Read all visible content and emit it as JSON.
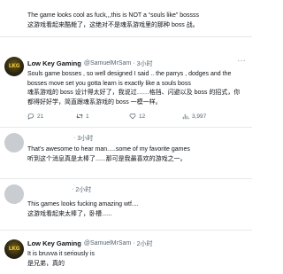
{
  "posts": [
    {
      "lines": [
        "The game looks cool as fuck,,,this is NOT a “souls like” bossss",
        "这游戏看起来酷毙了，这绝对不是魂系游戏里的那种 boss 战。"
      ]
    },
    {
      "name": "Low Key Gaming",
      "handle": "@SamuelMrSam",
      "time": "3小时",
      "more": "···",
      "lines": [
        "Souls game bosses , so well designed I said .. the parrys , dodges and the",
        "bosses  move set you gotta learn is exactly like a souls boss",
        "魂系游戏的 boss 设计得太好了，我说过……格挡、闪避以及 boss 的招式，你",
        "都得好好学，简直跟魂系游戏的 boss 一模一样。"
      ],
      "actions": {
        "replies": "21",
        "reposts": "1",
        "likes": "12",
        "views": "3,997"
      }
    },
    {
      "time": "3小时",
      "lines": [
        "That’s awesome to hear man.....some of my favorite games",
        "听到这个消息真是太棒了......那可是我最喜欢的游戏之一。"
      ]
    },
    {
      "time": "2小时",
      "lines": [
        "This games looks fucking amazing  wtf....",
        "这游戏看起来太棒了，卧槽......"
      ]
    },
    {
      "name": "Low Key Gaming",
      "handle": "@SamuelMrSam",
      "time": "2小时",
      "lines": [
        "It is bruvva it seriously is",
        "是兄弟，真的"
      ]
    }
  ],
  "logo_text": "LKG",
  "colors": {
    "muted": "#536471",
    "separator": "#e6e9eb",
    "logo_gold": "#e7c23a"
  },
  "icons": [
    "reply-icon",
    "repost-icon",
    "like-icon",
    "views-icon"
  ]
}
